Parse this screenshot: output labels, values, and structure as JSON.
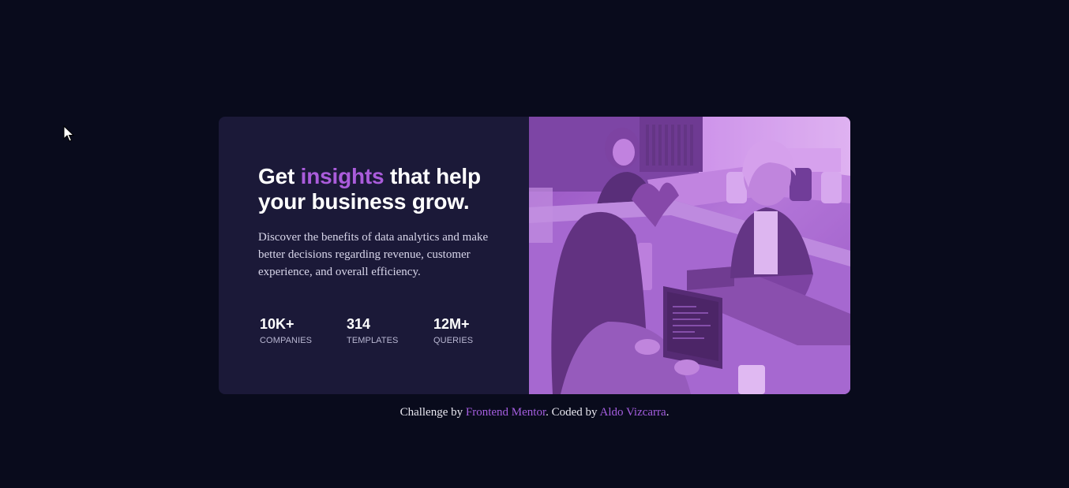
{
  "card": {
    "headline": {
      "prefix": "Get ",
      "accent": "insights",
      "suffix": " that help your business grow."
    },
    "description": "Discover the benefits of data analytics and make better decisions regarding revenue, customer experience, and overall efficiency.",
    "stats": [
      {
        "value": "10K+",
        "label": "COMPANIES"
      },
      {
        "value": "314",
        "label": "TEMPLATES"
      },
      {
        "value": "12M+",
        "label": "QUERIES"
      }
    ],
    "image_icon": "office-team-photo"
  },
  "footer": {
    "text1": "Challenge by ",
    "link1": "Frontend Mentor",
    "text2": ". Coded by ",
    "link2": "Aldo Vizcarra",
    "text3": "."
  },
  "colors": {
    "page_bg": "#090b1c",
    "card_bg": "#1b1938",
    "accent": "#aa5cdb",
    "image_overlay": "#ab5cdb"
  },
  "cursor_icon": "mouse-pointer-icon"
}
